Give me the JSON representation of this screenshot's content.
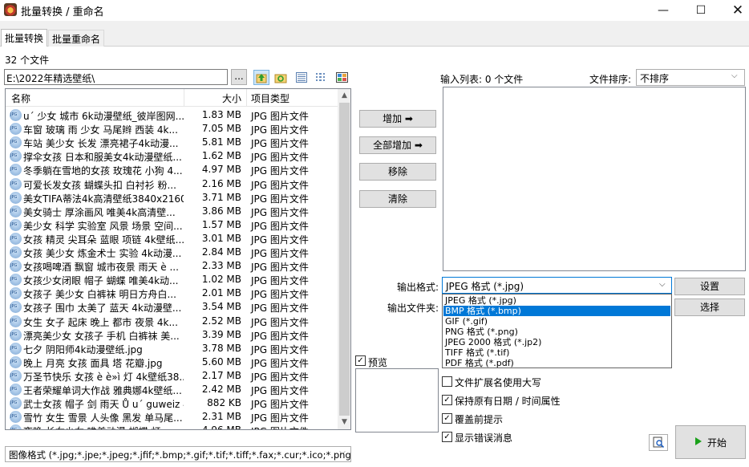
{
  "window": {
    "title": "批量转换 / 重命名"
  },
  "tabs": [
    {
      "label": "批量转换"
    },
    {
      "label": "批量重命名"
    }
  ],
  "file_count": "32 个文件",
  "path": {
    "value": "E:\\2022年精选壁纸\\",
    "browse": "..."
  },
  "file_list": {
    "columns": {
      "name": "名称",
      "size": "大小",
      "type": "项目类型"
    },
    "rows": [
      {
        "name": "u´ 少女 城市 6k动漫壁纸_彼岸图网...",
        "size": "1.83 MB",
        "type": "JPG 图片文件"
      },
      {
        "name": "车窗 玻璃 雨 少女 马尾辫 西装 4k...",
        "size": "7.05 MB",
        "type": "JPG 图片文件"
      },
      {
        "name": "车站 美少女 长发 漂亮裙子4k动漫...",
        "size": "5.81 MB",
        "type": "JPG 图片文件"
      },
      {
        "name": "撑伞女孩 日本和服美女4k动漫壁纸...",
        "size": "1.62 MB",
        "type": "JPG 图片文件"
      },
      {
        "name": "冬季躺在雪地的女孩 玫瑰花 小狗 4...",
        "size": "4.97 MB",
        "type": "JPG 图片文件"
      },
      {
        "name": "可爱长发女孩 蝴蝶头扣 白衬衫 粉...",
        "size": "2.16 MB",
        "type": "JPG 图片文件"
      },
      {
        "name": "美女TIFA蒂法4k高清壁纸3840x2160...",
        "size": "3.71 MB",
        "type": "JPG 图片文件"
      },
      {
        "name": "美女骑士 厚涂画风 唯美4k高清壁...",
        "size": "3.86 MB",
        "type": "JPG 图片文件"
      },
      {
        "name": "美少女 科学 实验室 风景 场景 空间...",
        "size": "1.57 MB",
        "type": "JPG 图片文件"
      },
      {
        "name": "女孩 精灵 尖耳朵 蓝眼 项链 4k壁纸...",
        "size": "3.01 MB",
        "type": "JPG 图片文件"
      },
      {
        "name": "女孩 美少女 炼金术士 实验 4k动漫...",
        "size": "2.84 MB",
        "type": "JPG 图片文件"
      },
      {
        "name": "女孩喝啤酒 飘窗 城市夜景 雨天 è ...",
        "size": "2.33 MB",
        "type": "JPG 图片文件"
      },
      {
        "name": "女孩少女闭眼 帽子 蝴蝶 唯美4k动...",
        "size": "1.02 MB",
        "type": "JPG 图片文件"
      },
      {
        "name": "女孩子 美少女 白裤袜 明日方舟白...",
        "size": "2.01 MB",
        "type": "JPG 图片文件"
      },
      {
        "name": "女孩子 围巾 太美了 蓝天 4k动漫壁...",
        "size": "3.54 MB",
        "type": "JPG 图片文件"
      },
      {
        "name": "女生 女子 起床 晚上 都市 夜景 4k...",
        "size": "2.52 MB",
        "type": "JPG 图片文件"
      },
      {
        "name": "漂亮美少女 女孩子 手机 白裤袜 美...",
        "size": "3.39 MB",
        "type": "JPG 图片文件"
      },
      {
        "name": "七夕 阴阳师4k动漫壁纸.jpg",
        "size": "3.78 MB",
        "type": "JPG 图片文件"
      },
      {
        "name": "晚上 月亮 女孩 面具 塔 花瓣.jpg",
        "size": "5.60 MB",
        "type": "JPG 图片文件"
      },
      {
        "name": "万圣节快乐 女孩 è è»ì 灯 4k壁纸38...",
        "size": "2.17 MB",
        "type": "JPG 图片文件"
      },
      {
        "name": "王者荣耀单词大作战 雅典娜4k壁纸...",
        "size": "2.42 MB",
        "type": "JPG 图片文件"
      },
      {
        "name": "武士女孩 帽子 剑 雨天 Ů u´ guweiz 4...",
        "size": "882 KB",
        "type": "JPG 图片文件"
      },
      {
        "name": "雪竹 女生 雪景 人头像 黑发 单马尾...",
        "size": "2.31 MB",
        "type": "JPG 图片文件"
      },
      {
        "name": "夜晚 长女少女 唯美动漫 蝴蝶 灯 ...",
        "size": "4.96 MB",
        "type": "JPG 图片文件"
      }
    ]
  },
  "filter": {
    "value": "图像格式 (*.jpg;*.jpe;*.jpeg;*.jfif;*.bmp;*.gif;*.tif;*.tiff;*.fax;*.cur;*.ico;*.png;*"
  },
  "buttons": {
    "add": "增加 ➡",
    "add_all": "全部增加 ➡",
    "remove": "移除",
    "clear": "清除",
    "settings": "设置",
    "select": "选择",
    "start": "开始"
  },
  "input_list": {
    "label": "输入列表: 0 个文件"
  },
  "sort": {
    "label": "文件排序:",
    "value": "不排序"
  },
  "output": {
    "format_label": "输出格式:",
    "format_value": "JPEG 格式 (*.jpg)",
    "folder_label": "输出文件夹:",
    "format_options": [
      "JPEG 格式 (*.jpg)",
      "BMP 格式 (*.bmp)",
      "GIF (*.gif)",
      "PNG 格式 (*.png)",
      "JPEG 2000 格式 (*.jp2)",
      "TIFF 格式 (*.tif)",
      "PDF 格式 (*.pdf)"
    ],
    "highlighted_index": 1
  },
  "preview": {
    "label": "预览",
    "checked": true
  },
  "options": [
    {
      "label": "文件扩展名使用大写",
      "checked": false
    },
    {
      "label": "保持原有日期 / 时间属性",
      "checked": true
    },
    {
      "label": "覆盖前提示",
      "checked": true
    },
    {
      "label": "显示错误消息",
      "checked": true
    }
  ],
  "colors": {
    "selection": "#0078d7",
    "start_arrow": "#1aa11a",
    "up_arrow": "#2e9d2e"
  }
}
